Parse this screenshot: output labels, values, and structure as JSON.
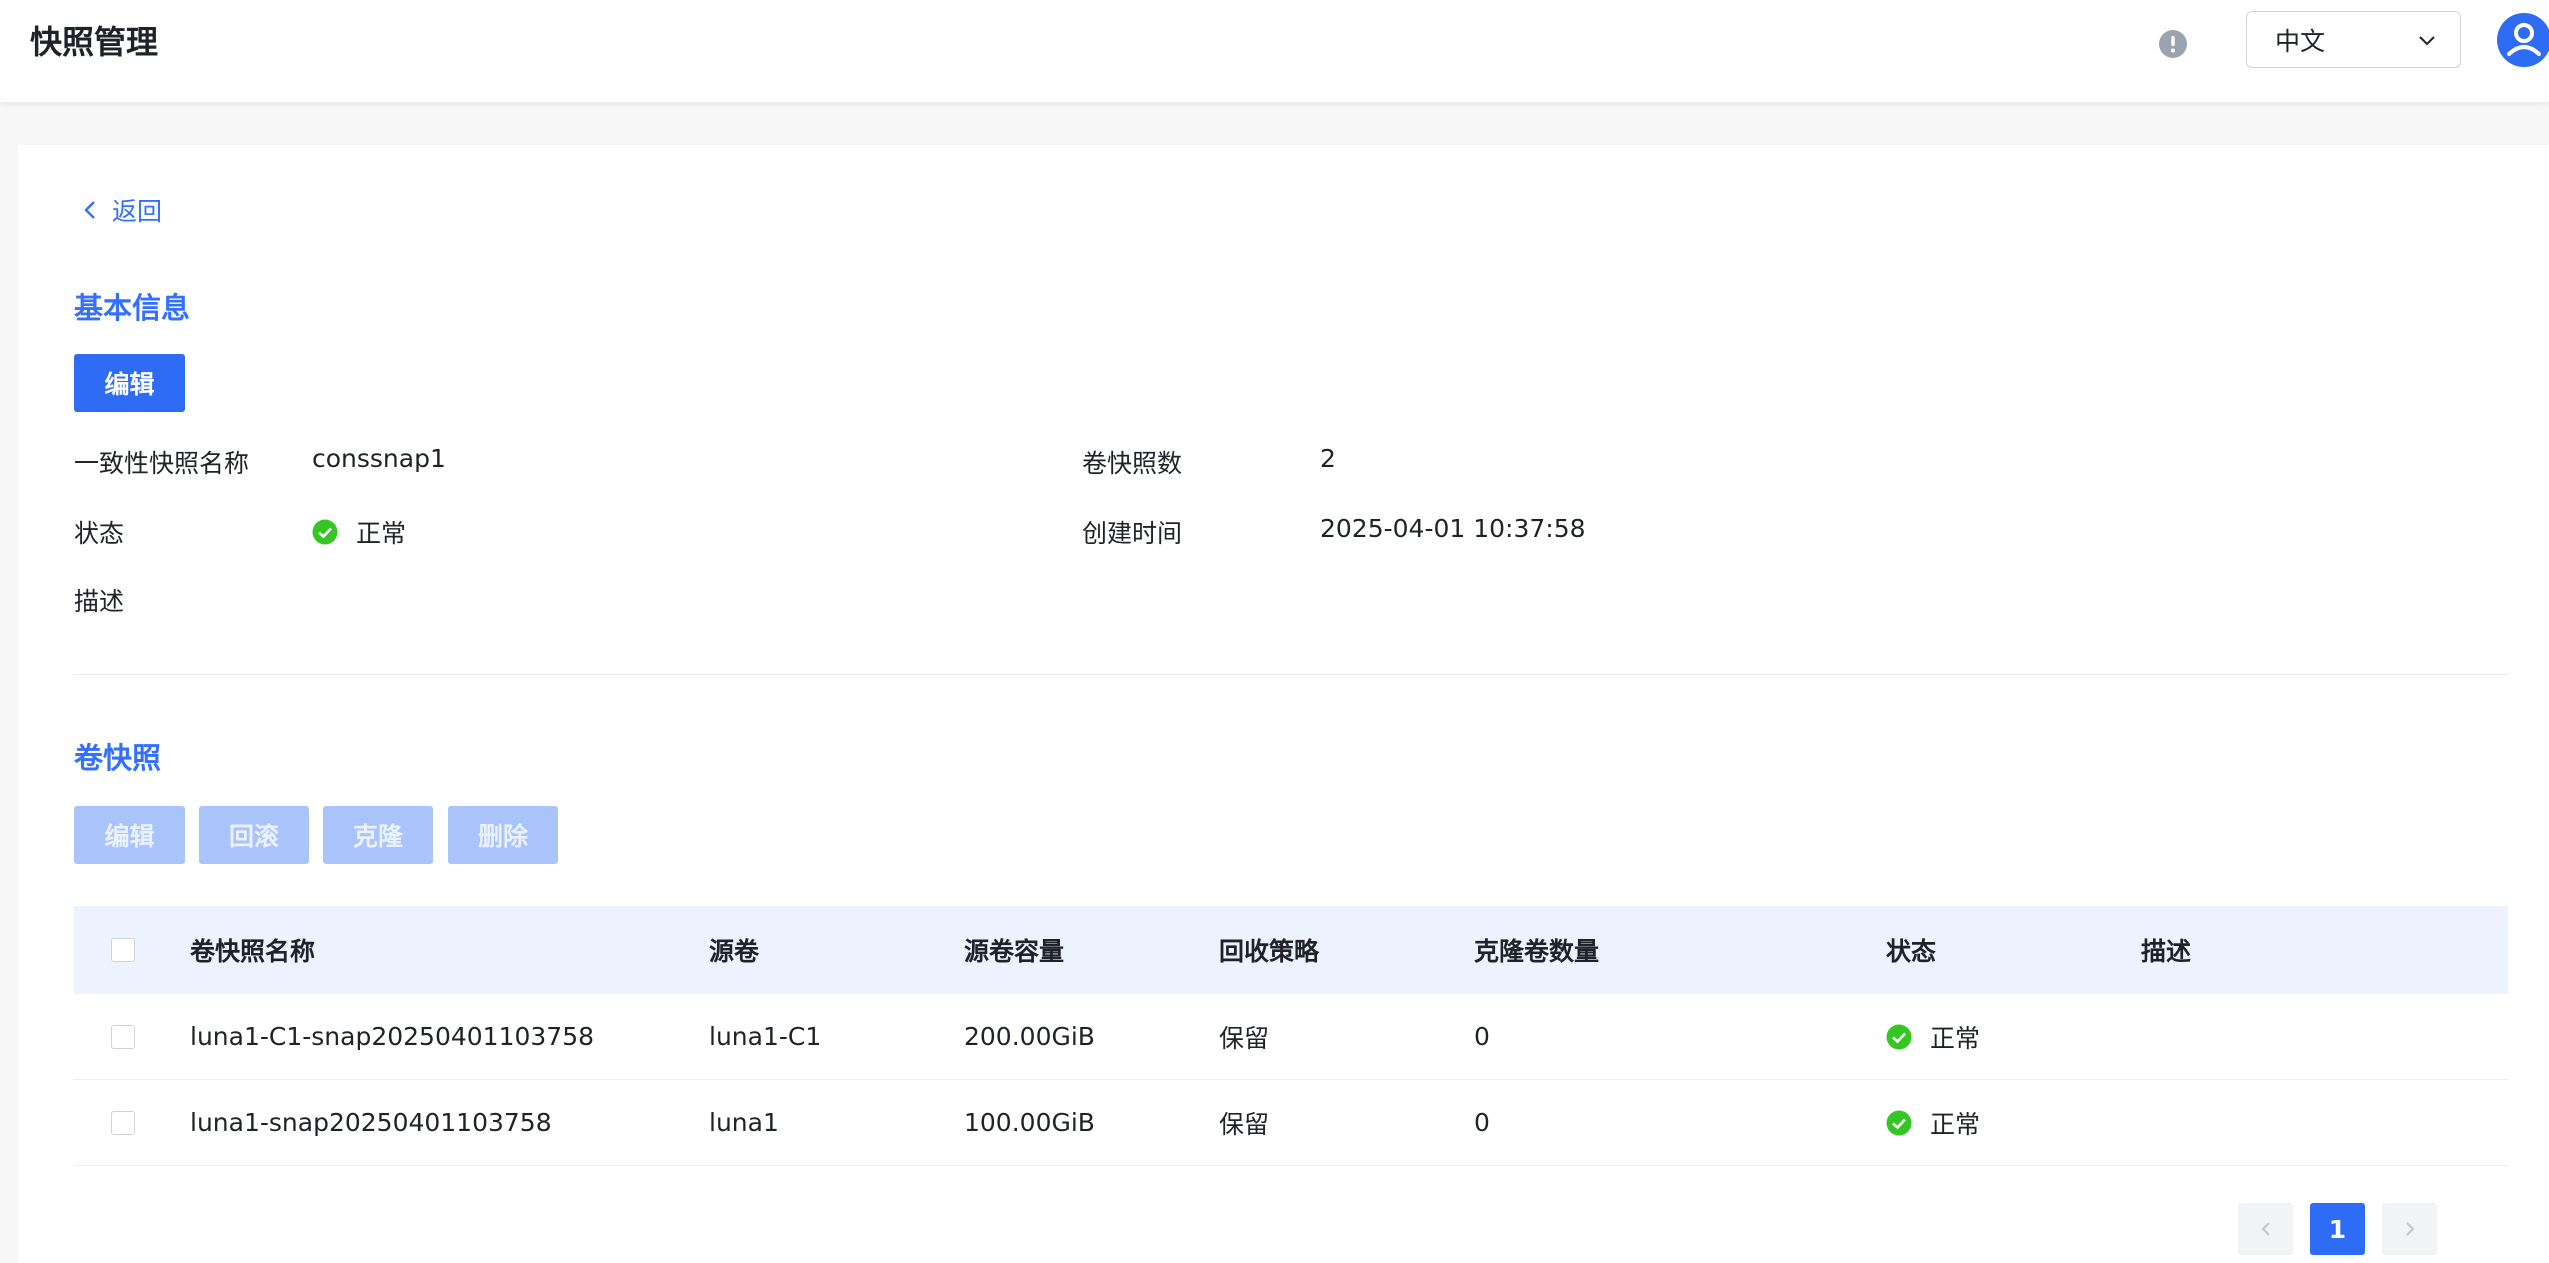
{
  "header": {
    "title": "快照管理",
    "language": "中文"
  },
  "back": {
    "label": "返回"
  },
  "basic_info": {
    "title": "基本信息",
    "edit_label": "编辑",
    "fields": {
      "name_label": "一致性快照名称",
      "name_value": "conssnap1",
      "status_label": "状态",
      "status_value": "正常",
      "description_label": "描述",
      "description_value": "",
      "volume_snapshots_label": "卷快照数",
      "volume_snapshots_value": "2",
      "created_label": "创建时间",
      "created_value": "2025-04-01 10:37:58"
    }
  },
  "volume_snapshots": {
    "title": "卷快照",
    "actions": {
      "edit": "编辑",
      "rollback": "回滚",
      "clone": "克隆",
      "delete": "删除"
    },
    "columns": {
      "name": "卷快照名称",
      "source": "源卷",
      "capacity": "源卷容量",
      "policy": "回收策略",
      "clones": "克隆卷数量",
      "status": "状态",
      "description": "描述"
    },
    "rows": [
      {
        "name": "luna1-C1-snap20250401103758",
        "source": "luna1-C1",
        "capacity": "200.00GiB",
        "policy": "保留",
        "clones": "0",
        "status": "正常",
        "description": ""
      },
      {
        "name": "luna1-snap20250401103758",
        "source": "luna1",
        "capacity": "100.00GiB",
        "policy": "保留",
        "clones": "0",
        "status": "正常",
        "description": ""
      }
    ]
  },
  "pagination": {
    "current": "1"
  },
  "colors": {
    "primary": "#2e6cf6",
    "link": "#3370ff",
    "success": "#34c724",
    "header_row": "#ecf3fe"
  },
  "icons": {
    "info": "info-circle-icon",
    "chevron": "chevron-down-icon",
    "avatar": "user-avatar-icon",
    "back": "chevron-left-icon",
    "status": "check-circle-icon"
  }
}
